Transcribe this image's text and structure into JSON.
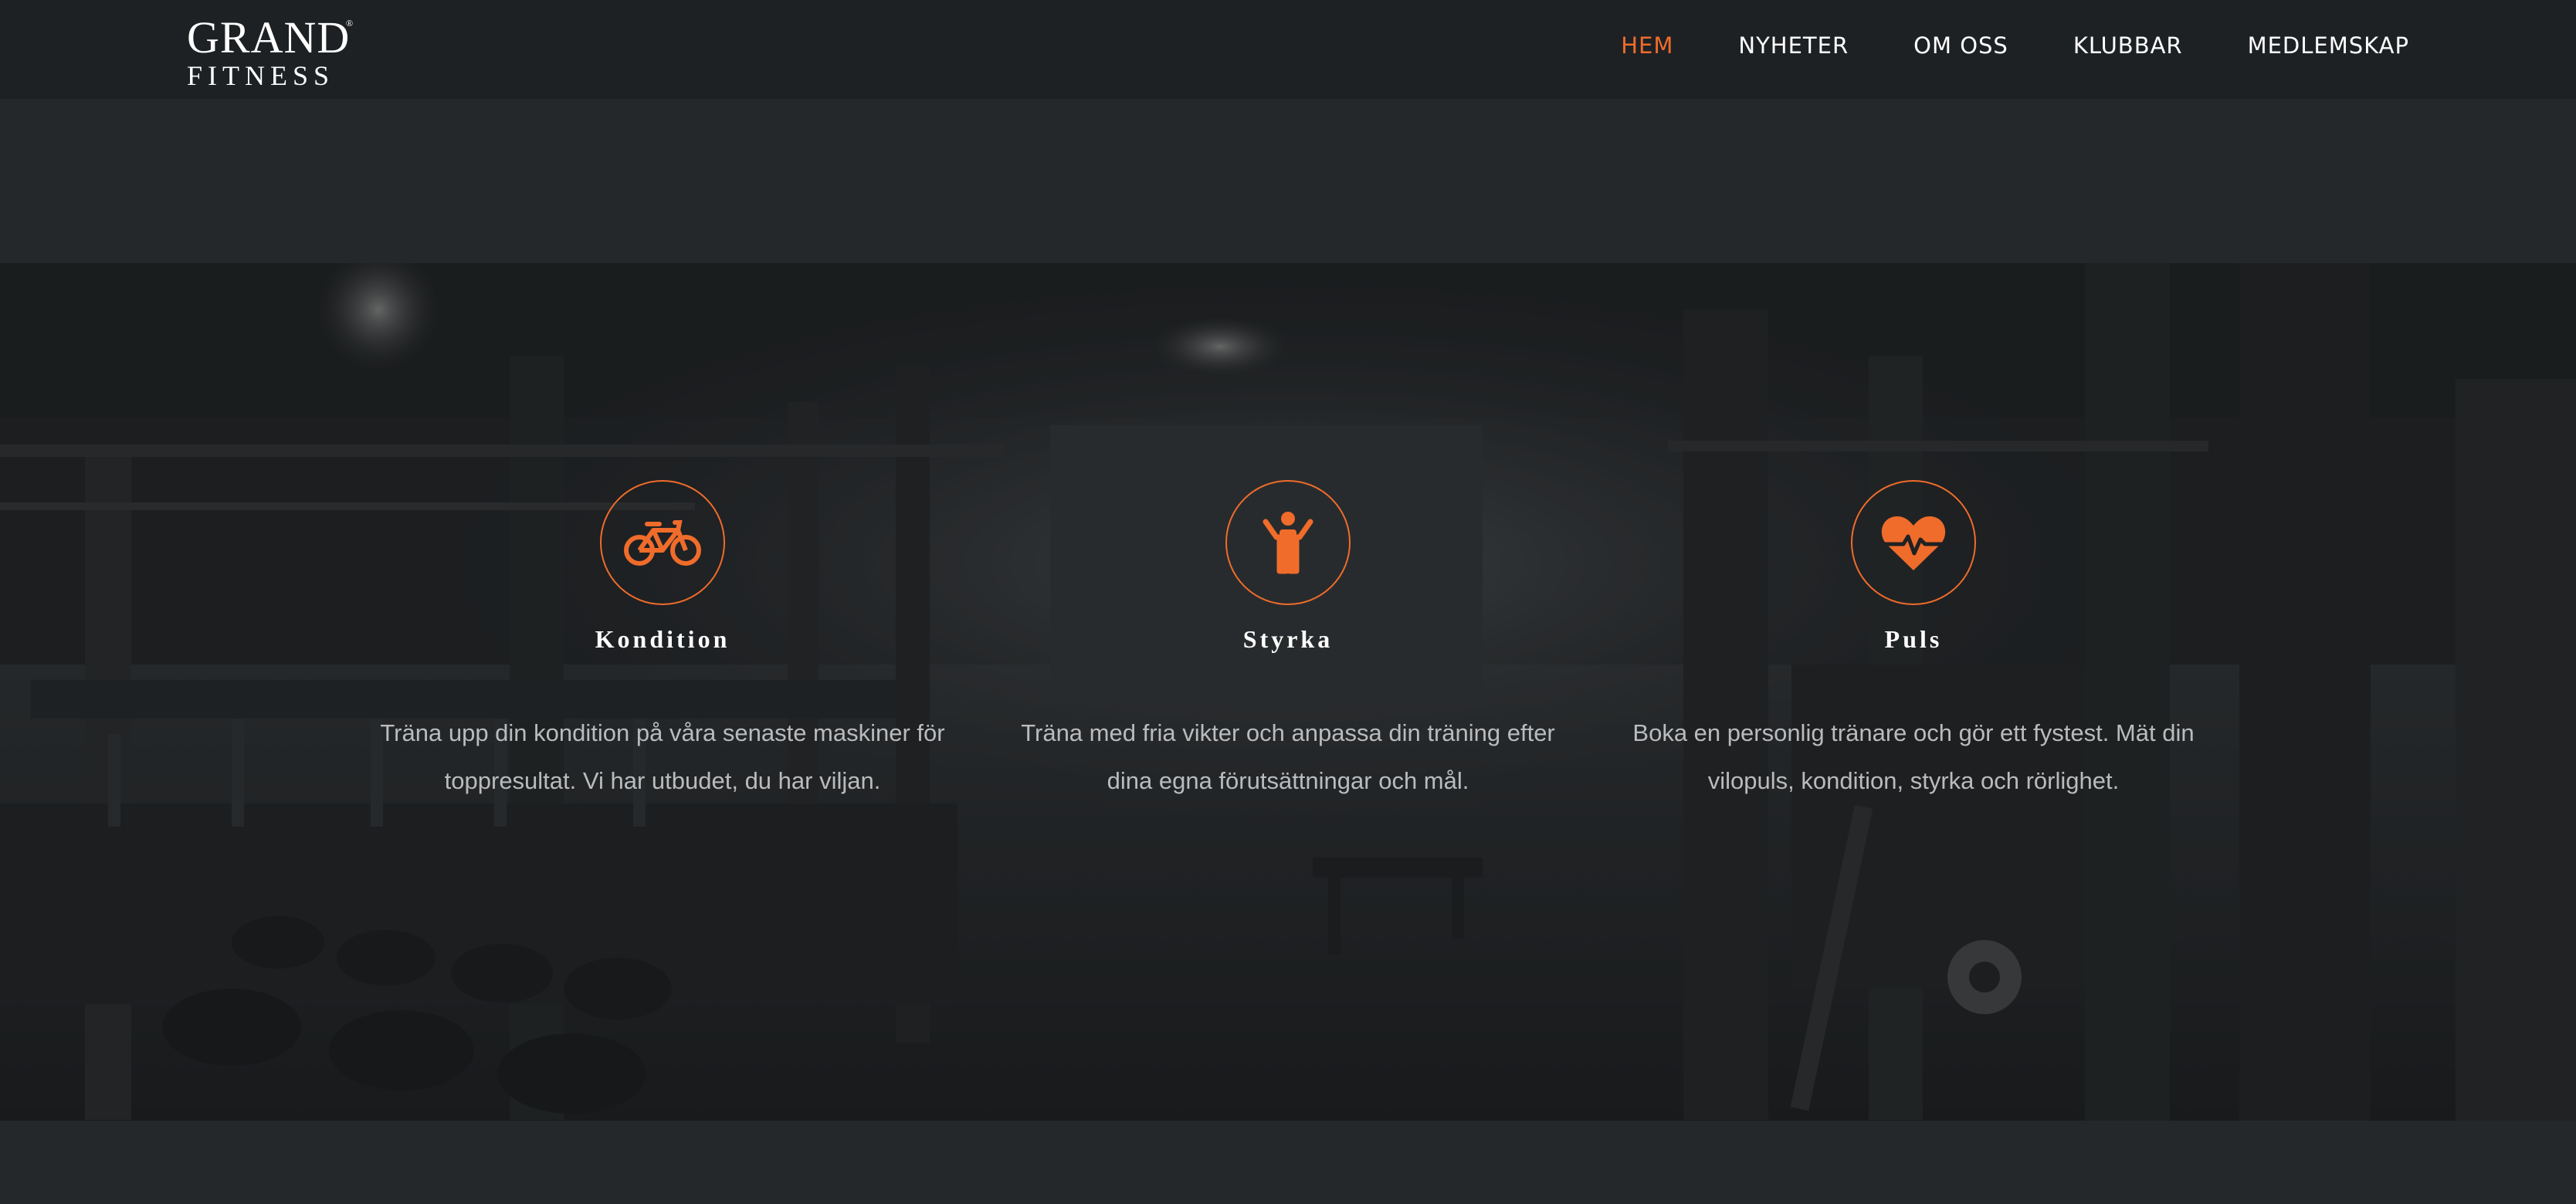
{
  "header": {
    "logo_top": "GRAND",
    "logo_bottom": "FITNESS",
    "logo_mark": "®",
    "nav": [
      {
        "label": "HEM",
        "active": true
      },
      {
        "label": "NYHETER",
        "active": false
      },
      {
        "label": "OM OSS",
        "active": false
      },
      {
        "label": "KLUBBAR",
        "active": false
      },
      {
        "label": "MEDLEMSKAP",
        "active": false
      }
    ]
  },
  "features": [
    {
      "icon": "bicycle-icon",
      "title": "Kondition",
      "text_line1": "Träna upp din kondition på våra senaste maskiner för",
      "text_line2": "toppresultat. Vi har utbudet, du har viljan."
    },
    {
      "icon": "person-icon",
      "title": "Styrka",
      "text_line1": "Träna med fria vikter och anpassa din träning efter",
      "text_line2": "dina egna förutsättningar och mål."
    },
    {
      "icon": "heartbeat-icon",
      "title": "Puls",
      "text_line1": "Boka en personlig tränare och gör ett fystest. Mät din",
      "text_line2": "vilopuls, kondition, styrka och rörlighet."
    }
  ],
  "colors": {
    "accent": "#ef6c2b",
    "header_bg": "#1e2124",
    "page_bg": "#25282b",
    "text_muted": "#b9bbbd"
  }
}
